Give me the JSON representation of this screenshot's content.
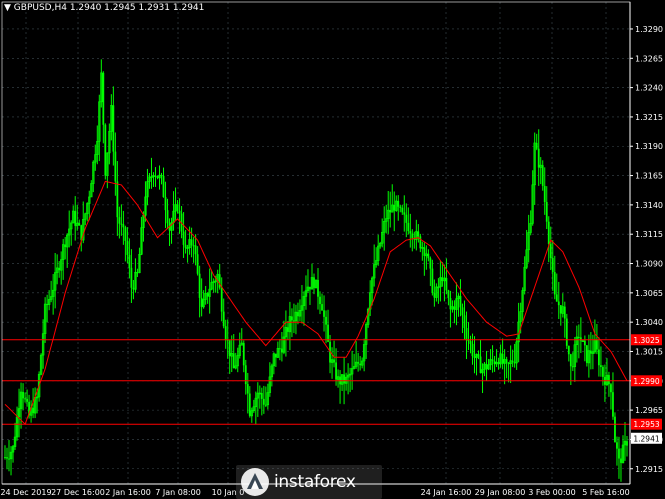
{
  "header": {
    "symbol_line": "GBPUSD,H4  1.2940 1.2945 1.2931 1.2941",
    "dropdown_glyph": "▼"
  },
  "watermark": {
    "text": "instaforex",
    "icon": "instaforex-logo-icon"
  },
  "colors": {
    "background": "#000000",
    "candle": "#00ff00",
    "moving_average": "#ff0000",
    "level_line": "#ff0000",
    "current_price_tag": "#ffffff",
    "grid": "#3c4a50",
    "axis_text": "#ffffff"
  },
  "chart_data": {
    "type": "candlestick",
    "symbol": "GBPUSD",
    "timeframe": "H4",
    "ohlc_last": {
      "open": 1.294,
      "high": 1.2945,
      "low": 1.2931,
      "close": 1.2941
    },
    "ylim": [
      1.2902,
      1.3313
    ],
    "y_ticks": [
      1.2915,
      1.294,
      1.2965,
      1.299,
      1.3015,
      1.304,
      1.3065,
      1.309,
      1.3115,
      1.314,
      1.3165,
      1.319,
      1.3215,
      1.324,
      1.3265,
      1.329
    ],
    "x_ticks": [
      "24 Dec 2019",
      "27 Dec 16:00",
      "2 Jan 16:00",
      "7 Jan 08:00",
      "10 Jan 0",
      "24 Jan 16:00",
      "29 Jan 08:00",
      "3 Feb 00:00",
      "5 Feb 16:00"
    ],
    "horizontal_levels": [
      {
        "value": 1.3025,
        "label": "1.3025"
      },
      {
        "value": 1.299,
        "label": "1.2990"
      },
      {
        "value": 1.2953,
        "label": "1.2953"
      }
    ],
    "current_price": {
      "value": 1.2941,
      "label": "1.2941"
    },
    "grid": true,
    "moving_average_anchors": [
      [
        0,
        1.297
      ],
      [
        10,
        1.2953
      ],
      [
        20,
        1.3
      ],
      [
        30,
        1.3065
      ],
      [
        40,
        1.312
      ],
      [
        50,
        1.316
      ],
      [
        58,
        1.3157
      ],
      [
        66,
        1.314
      ],
      [
        76,
        1.3112
      ],
      [
        86,
        1.3128
      ],
      [
        96,
        1.311
      ],
      [
        104,
        1.308
      ],
      [
        112,
        1.306
      ],
      [
        120,
        1.304
      ],
      [
        130,
        1.302
      ],
      [
        140,
        1.304
      ],
      [
        148,
        1.304
      ],
      [
        156,
        1.303
      ],
      [
        164,
        1.301
      ],
      [
        170,
        1.301
      ],
      [
        176,
        1.3028
      ],
      [
        184,
        1.306
      ],
      [
        192,
        1.31
      ],
      [
        200,
        1.311
      ],
      [
        206,
        1.3112
      ],
      [
        212,
        1.3105
      ],
      [
        220,
        1.3085
      ],
      [
        230,
        1.306
      ],
      [
        240,
        1.304
      ],
      [
        250,
        1.3028
      ],
      [
        256,
        1.303
      ],
      [
        262,
        1.306
      ],
      [
        268,
        1.309
      ],
      [
        272,
        1.311
      ],
      [
        278,
        1.31
      ],
      [
        286,
        1.307
      ],
      [
        294,
        1.303
      ],
      [
        302,
        1.3015
      ],
      [
        310,
        1.299
      ]
    ],
    "price_path_anchors": [
      [
        0,
        1.2925
      ],
      [
        4,
        1.2932
      ],
      [
        8,
        1.2985
      ],
      [
        12,
        1.296
      ],
      [
        16,
        1.2975
      ],
      [
        20,
        1.305
      ],
      [
        24,
        1.307
      ],
      [
        30,
        1.311
      ],
      [
        34,
        1.313
      ],
      [
        38,
        1.3115
      ],
      [
        42,
        1.315
      ],
      [
        46,
        1.32
      ],
      [
        48,
        1.325
      ],
      [
        50,
        1.317
      ],
      [
        53,
        1.322
      ],
      [
        56,
        1.313
      ],
      [
        60,
        1.311
      ],
      [
        63,
        1.307
      ],
      [
        66,
        1.308
      ],
      [
        70,
        1.315
      ],
      [
        74,
        1.317
      ],
      [
        78,
        1.316
      ],
      [
        82,
        1.312
      ],
      [
        86,
        1.314
      ],
      [
        90,
        1.31
      ],
      [
        94,
        1.311
      ],
      [
        98,
        1.305
      ],
      [
        102,
        1.307
      ],
      [
        106,
        1.308
      ],
      [
        110,
        1.303
      ],
      [
        114,
        1.3
      ],
      [
        118,
        1.302
      ],
      [
        122,
        1.2965
      ],
      [
        126,
        1.298
      ],
      [
        130,
        1.297
      ],
      [
        134,
        1.301
      ],
      [
        138,
        1.302
      ],
      [
        142,
        1.304
      ],
      [
        146,
        1.305
      ],
      [
        150,
        1.307
      ],
      [
        154,
        1.3075
      ],
      [
        158,
        1.3055
      ],
      [
        162,
        1.301
      ],
      [
        166,
        1.299
      ],
      [
        170,
        1.299
      ],
      [
        174,
        1.3
      ],
      [
        178,
        1.301
      ],
      [
        182,
        1.307
      ],
      [
        186,
        1.31
      ],
      [
        190,
        1.313
      ],
      [
        194,
        1.314
      ],
      [
        198,
        1.313
      ],
      [
        202,
        1.312
      ],
      [
        206,
        1.311
      ],
      [
        210,
        1.31
      ],
      [
        214,
        1.306
      ],
      [
        218,
        1.308
      ],
      [
        222,
        1.305
      ],
      [
        226,
        1.306
      ],
      [
        230,
        1.303
      ],
      [
        234,
        1.301
      ],
      [
        238,
        1.3
      ],
      [
        242,
        1.3005
      ],
      [
        246,
        1.301
      ],
      [
        250,
        1.3
      ],
      [
        254,
        1.301
      ],
      [
        258,
        1.307
      ],
      [
        262,
        1.313
      ],
      [
        264,
        1.319
      ],
      [
        267,
        1.317
      ],
      [
        270,
        1.313
      ],
      [
        274,
        1.306
      ],
      [
        278,
        1.305
      ],
      [
        282,
        1.3
      ],
      [
        286,
        1.303
      ],
      [
        290,
        1.301
      ],
      [
        294,
        1.302
      ],
      [
        298,
        1.2995
      ],
      [
        302,
        1.2985
      ],
      [
        304,
        1.294
      ],
      [
        306,
        1.292
      ],
      [
        310,
        1.2939
      ]
    ]
  }
}
